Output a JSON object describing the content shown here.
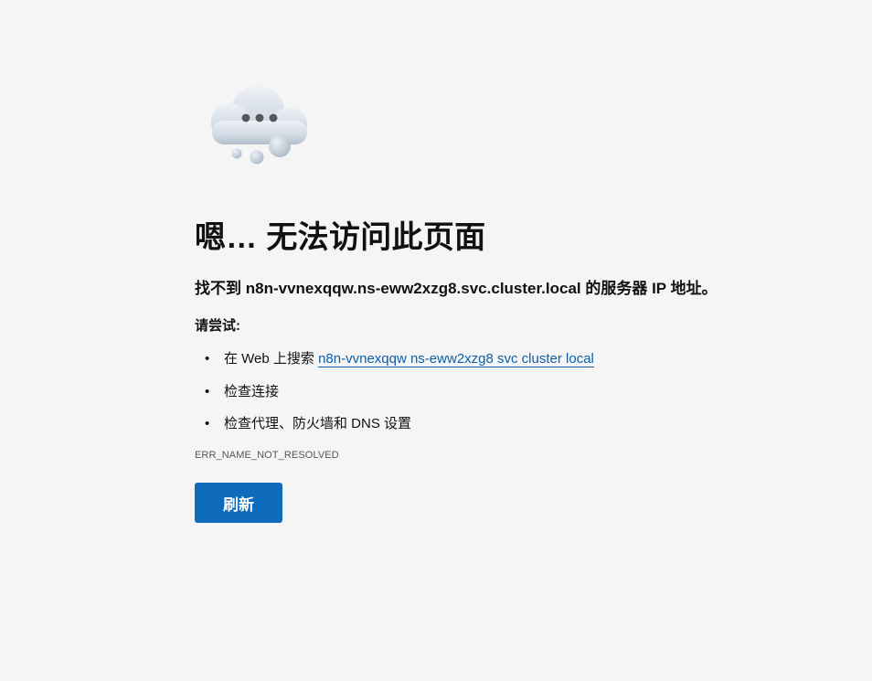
{
  "illustration": {
    "icon": "cloud-thinking-icon"
  },
  "error": {
    "title": "嗯… 无法访问此页面",
    "subtitle_prefix": "找不到 ",
    "hostname": "n8n-vvnexqqw.ns-eww2xzg8.svc.cluster.local",
    "subtitle_suffix": " 的服务器 IP 地址。",
    "try_label": "请尝试:",
    "suggestions": {
      "search_prefix": "在 Web 上搜索 ",
      "search_link": "n8n-vvnexqqw ns-eww2xzg8 svc cluster local",
      "check_connection": "检查连接",
      "check_proxy": "检查代理、防火墙和 DNS 设置"
    },
    "code": "ERR_NAME_NOT_RESOLVED",
    "refresh_label": "刷新"
  },
  "colors": {
    "background": "#f5f5f5",
    "accent": "#0f6cbd",
    "link": "#0f5ea8",
    "text": "#111111"
  }
}
